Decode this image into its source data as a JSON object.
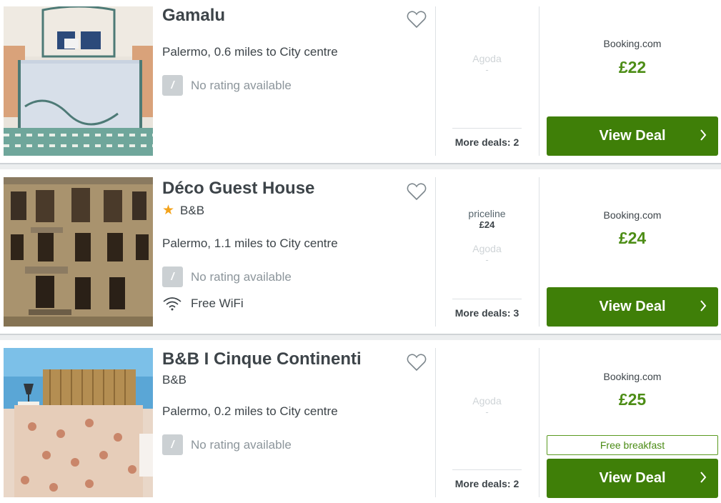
{
  "listings": [
    {
      "name": "Gamalu",
      "type": "",
      "location": "Palermo, 0.6 miles to City centre",
      "rating_icon": "/",
      "rating_text": "No rating available",
      "amenity": "",
      "providers": [
        {
          "name": "Agoda",
          "price": "-"
        }
      ],
      "more_deals": "More deals: 2",
      "main_site": "Booking.com",
      "main_price": "£22",
      "badge": "",
      "cta": "View Deal"
    },
    {
      "name": "Déco Guest House",
      "type": "B&B",
      "location": "Palermo, 1.1 miles to City centre",
      "rating_icon": "/",
      "rating_text": "No rating available",
      "amenity": "Free WiFi",
      "providers": [
        {
          "name": "priceline",
          "price": "£24"
        },
        {
          "name": "Agoda",
          "price": "-"
        }
      ],
      "more_deals": "More deals: 3",
      "main_site": "Booking.com",
      "main_price": "£24",
      "badge": "",
      "cta": "View Deal"
    },
    {
      "name": "B&B I Cinque Continenti",
      "type": "B&B",
      "location": "Palermo, 0.2 miles to City centre",
      "rating_icon": "/",
      "rating_text": "No rating available",
      "amenity": "",
      "providers": [
        {
          "name": "Agoda",
          "price": "-"
        }
      ],
      "more_deals": "More deals: 2",
      "main_site": "Booking.com",
      "main_price": "£25",
      "badge": "Free breakfast",
      "cta": "View Deal"
    }
  ],
  "icons": {
    "favorite": "heart-outline-icon",
    "star": "star-icon",
    "wifi": "wifi-icon",
    "cta_arrow": "chevron-right-icon"
  },
  "colors": {
    "cta_background": "#3f7f08",
    "price": "#4d8d16",
    "star": "#f3a31b",
    "rating_box": "#cbd0d3"
  }
}
